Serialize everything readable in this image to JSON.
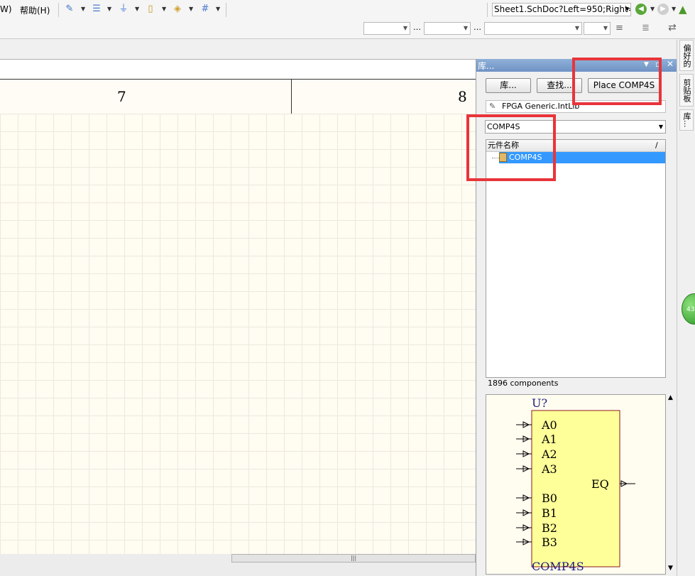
{
  "menu": {
    "help_partial": "W)",
    "help": "帮助(H)"
  },
  "toolbar": {
    "document_combo": "Sheet1.SchDoc?Left=950;Right=",
    "icons": [
      "wire-tool-icon",
      "bus-icon",
      "ground-icon",
      "part-icon",
      "port-icon",
      "grid-icon",
      "back-icon",
      "forward-icon",
      "home-icon"
    ]
  },
  "sheet": {
    "zones": [
      "7",
      "8"
    ]
  },
  "panel": {
    "title": "库...",
    "buttons": {
      "libraries": "库...",
      "search": "查找...",
      "place": "Place COMP4S"
    },
    "library_name": "FPGA Generic.IntLib",
    "filter_value": "COMP4S",
    "column_header": "元件名称",
    "sort_indicator": "/",
    "components": [
      {
        "name": "COMP4S",
        "selected": true
      }
    ],
    "component_count": "1896 components"
  },
  "preview": {
    "designator": "U?",
    "comment": "COMP4S",
    "pins_left": [
      "A0",
      "A1",
      "A2",
      "A3",
      "B0",
      "B1",
      "B2",
      "B3"
    ],
    "pins_right": [
      "EQ"
    ],
    "body_color": "#ffff99"
  },
  "dock_tabs": [
    "偏好的",
    "剪贴板",
    "库..."
  ],
  "badge": {
    "text": "43"
  },
  "highlight_color": "#e8343a"
}
